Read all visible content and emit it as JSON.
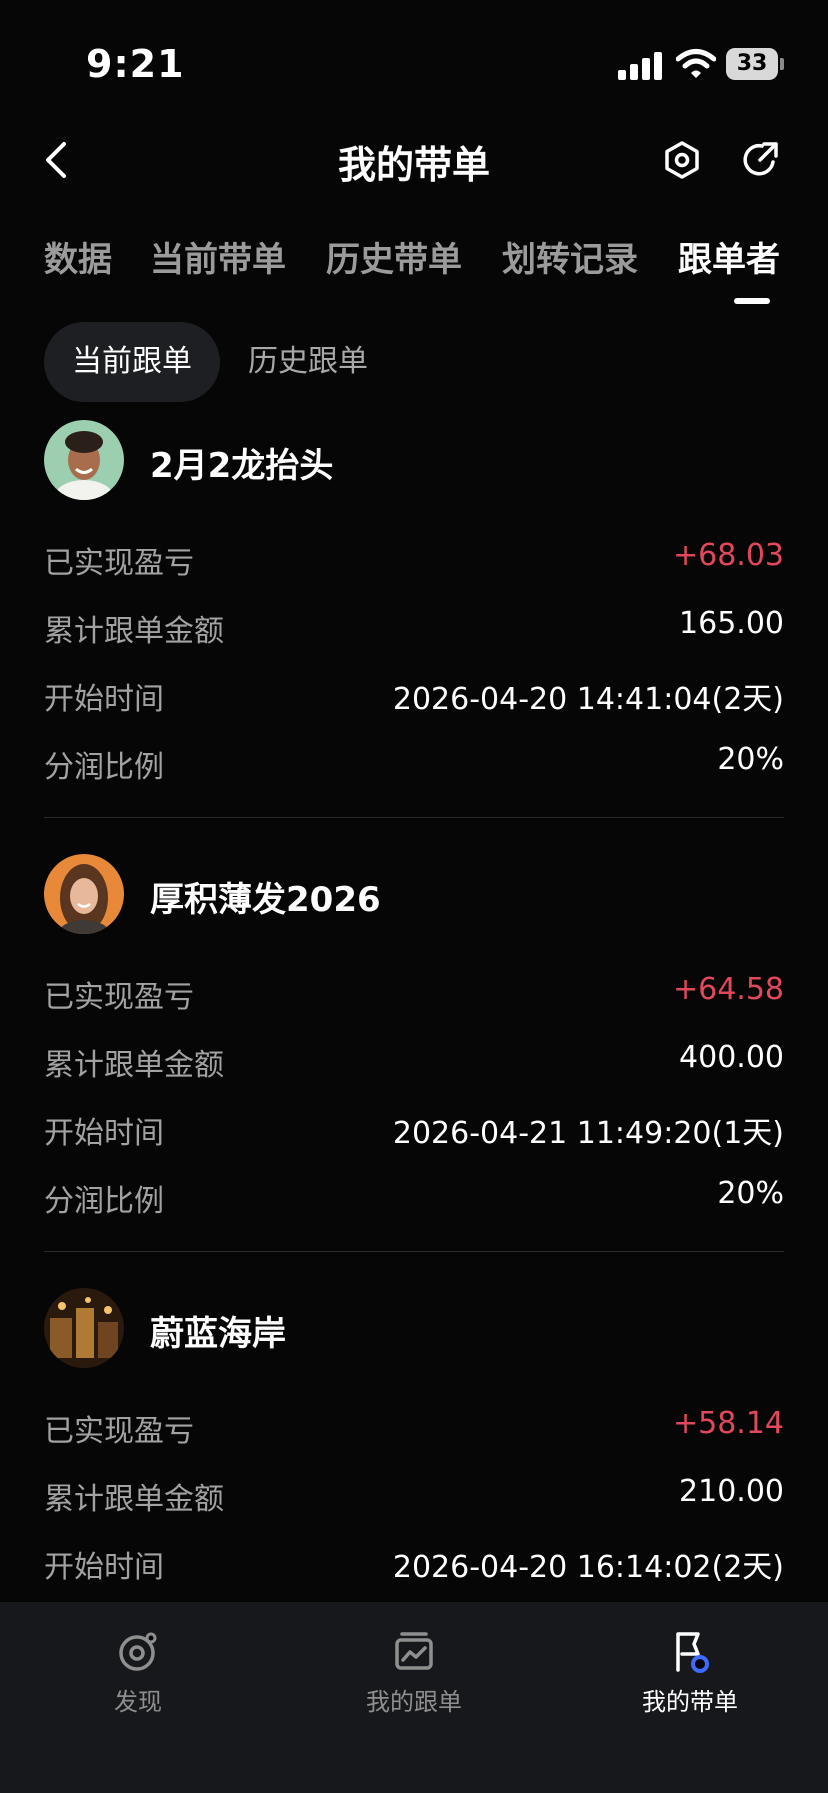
{
  "status_bar": {
    "time": "9:21",
    "battery": "33"
  },
  "nav": {
    "title": "我的带单"
  },
  "tabs": [
    {
      "label": "数据"
    },
    {
      "label": "当前带单"
    },
    {
      "label": "历史带单"
    },
    {
      "label": "划转记录"
    },
    {
      "label": "跟单者",
      "active": true
    }
  ],
  "subtabs": [
    {
      "label": "当前跟单",
      "active": true
    },
    {
      "label": "历史跟单"
    }
  ],
  "followers": [
    {
      "name": "2月2龙抬头",
      "rows": [
        {
          "label": "已实现盈亏",
          "value": "+68.03"
        },
        {
          "label": "累计跟单金额",
          "value": "165.00"
        },
        {
          "label": "开始时间",
          "value": "2026-04-20 14:41:04(2天)"
        },
        {
          "label": "分润比例",
          "value": "20%"
        }
      ]
    },
    {
      "name": "厚积薄发2026",
      "rows": [
        {
          "label": "已实现盈亏",
          "value": "+64.58"
        },
        {
          "label": "累计跟单金额",
          "value": "400.00"
        },
        {
          "label": "开始时间",
          "value": "2026-04-21 11:49:20(1天)"
        },
        {
          "label": "分润比例",
          "value": "20%"
        }
      ]
    },
    {
      "name": "蔚蓝海岸",
      "rows": [
        {
          "label": "已实现盈亏",
          "value": "+58.14"
        },
        {
          "label": "累计跟单金额",
          "value": "210.00"
        },
        {
          "label": "开始时间",
          "value": "2026-04-20 16:14:02(2天)"
        }
      ]
    }
  ],
  "bottom_nav": [
    {
      "label": "发现",
      "icon": "discover-icon"
    },
    {
      "label": "我的跟单",
      "icon": "chart-card-icon"
    },
    {
      "label": "我的带单",
      "icon": "flag-badge-icon",
      "active": true
    }
  ],
  "colors": {
    "profit": "#e2485c",
    "background": "#060606",
    "accent": "#3d6bff"
  }
}
